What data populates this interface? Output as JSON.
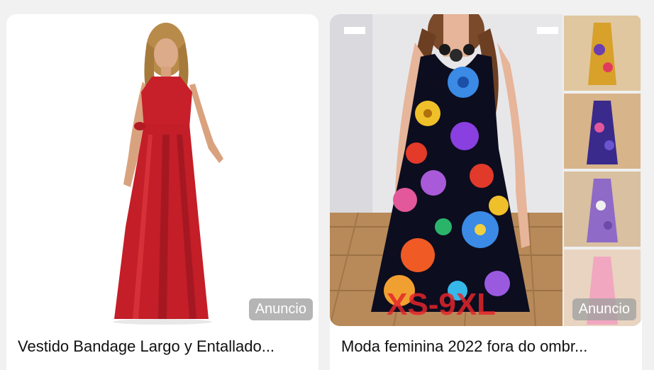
{
  "cards": [
    {
      "title": "Vestido Bandage Largo y Entallado...",
      "badge": "Anuncio",
      "image_alt": "red-halter-maxi-dress",
      "colors": {
        "dress": "#c8202a",
        "skin": "#d9a27e",
        "hair": "#b88b4a"
      }
    },
    {
      "title": "Moda feminina 2022 fora do ombr...",
      "badge": "Anuncio",
      "overlay_text": "XS-9XL",
      "image_alt": "floral-print-dress",
      "colors": {
        "dress": "#0c0d1f",
        "floor": "#b88a5a",
        "wall": "#e7e7ea",
        "overlay": "#e4262c"
      }
    }
  ]
}
